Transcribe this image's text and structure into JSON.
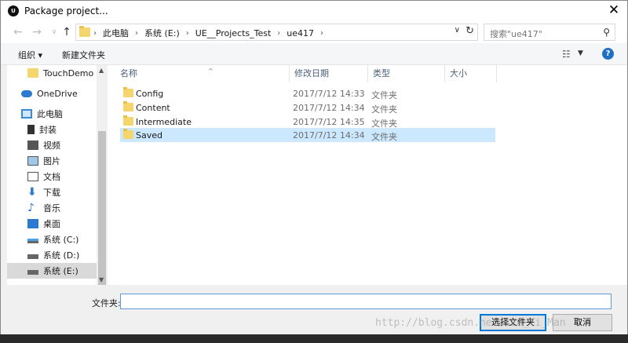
{
  "window": {
    "title": "Package project..."
  },
  "address": {
    "crumbs": [
      "此电脑",
      "系统 (E:)",
      "UE__Projects_Test",
      "ue417"
    ]
  },
  "search": {
    "placeholder": "搜索\"ue417\""
  },
  "toolbar": {
    "organize": "组织 ▾",
    "new_folder": "新建文件夹"
  },
  "sidebar": {
    "items": [
      {
        "label": "TouchDemo",
        "icon": "folder-icon"
      },
      {
        "label": "OneDrive",
        "icon": "cloud-icon"
      },
      {
        "label": "此电脑",
        "icon": "computer-icon"
      },
      {
        "label": "视频",
        "icon": "video-icon"
      },
      {
        "label": "图片",
        "icon": "picture-icon"
      },
      {
        "label": "文档",
        "icon": "document-icon"
      },
      {
        "label": "下载",
        "icon": "download-icon"
      },
      {
        "label": "音乐",
        "icon": "music-icon"
      },
      {
        "label": "桌面",
        "icon": "desktop-icon"
      },
      {
        "label": "系统 (C:)",
        "icon": "drive-icon"
      },
      {
        "label": "系统 (D:)",
        "icon": "drive-icon"
      },
      {
        "label": "系统 (E:)",
        "icon": "drive-icon"
      }
    ],
    "extra_item": {
      "label": "封装",
      "icon": "file-icon"
    }
  },
  "columns": {
    "name": "名称",
    "date": "修改日期",
    "type": "类型",
    "size": "大小"
  },
  "files": [
    {
      "name": "Config",
      "date": "2017/7/12 14:33",
      "type": "文件夹"
    },
    {
      "name": "Content",
      "date": "2017/7/12 14:34",
      "type": "文件夹"
    },
    {
      "name": "Intermediate",
      "date": "2017/7/12 14:35",
      "type": "文件夹"
    },
    {
      "name": "Saved",
      "date": "2017/7/12 14:34",
      "type": "文件夹"
    }
  ],
  "bottom": {
    "folder_label": "文件夹:",
    "folder_value": "",
    "select_button": "选择文件夹",
    "cancel_button": "取消"
  },
  "watermark": "http://blog.csdn.net/szu_Yi_Man"
}
